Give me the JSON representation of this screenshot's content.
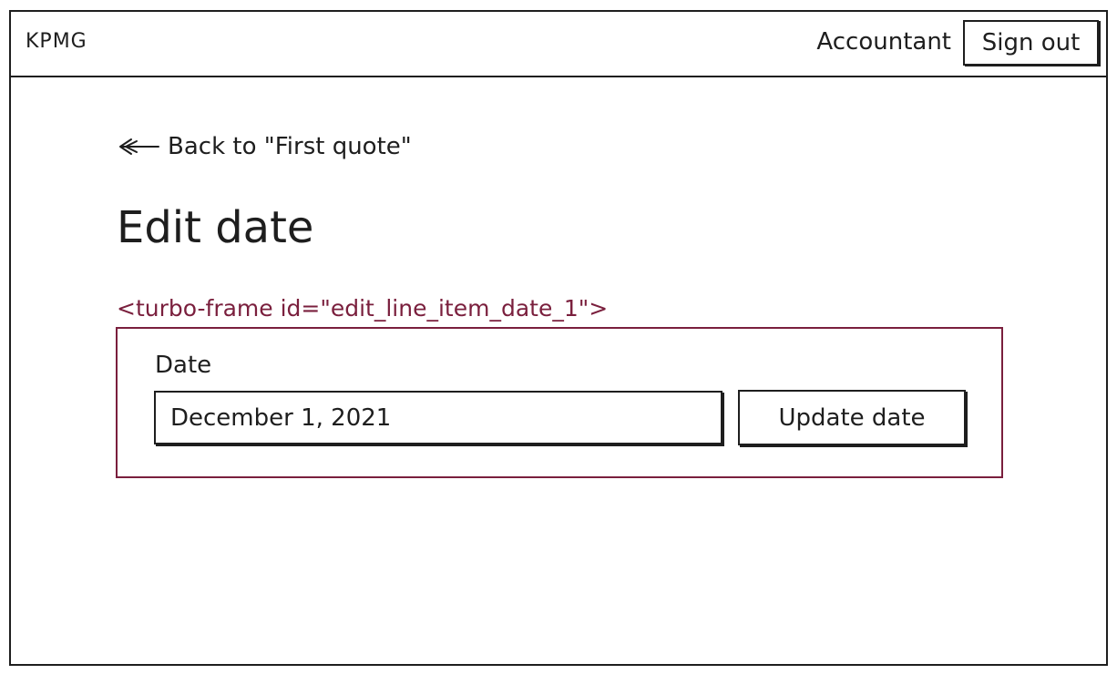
{
  "header": {
    "brand": "KPMG",
    "role": "Accountant",
    "sign_out_label": "Sign out"
  },
  "nav": {
    "back_label": "Back to \"First quote\""
  },
  "page": {
    "title": "Edit date"
  },
  "turbo_frame": {
    "tag_label": "<turbo-frame id=\"edit_line_item_date_1\">",
    "border_color": "#7a1f3d"
  },
  "form": {
    "date_label": "Date",
    "date_value": "December 1, 2021",
    "submit_label": "Update date"
  },
  "icons": {
    "back": "arrow-left-icon"
  }
}
